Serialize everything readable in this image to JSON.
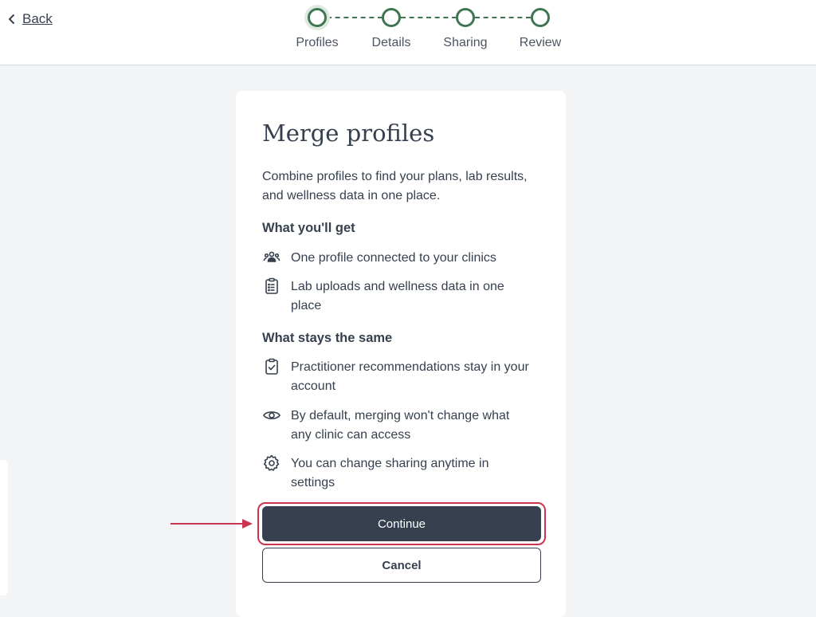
{
  "header": {
    "back_label": "Back",
    "steps": [
      {
        "label": "Profiles",
        "active": true
      },
      {
        "label": "Details",
        "active": false
      },
      {
        "label": "Sharing",
        "active": false
      },
      {
        "label": "Review",
        "active": false
      }
    ]
  },
  "card": {
    "title": "Merge profiles",
    "intro": "Combine profiles to find your plans, lab results, and wellness data in one place.",
    "section_get": {
      "heading": "What you'll get",
      "items": [
        {
          "icon": "people-icon",
          "text": "One profile connected to your clinics"
        },
        {
          "icon": "clipboard-list-icon",
          "text": "Lab uploads and wellness data in one place"
        }
      ]
    },
    "section_same": {
      "heading": "What stays the same",
      "items": [
        {
          "icon": "clipboard-check-icon",
          "text": "Practitioner recommendations stay in your account"
        },
        {
          "icon": "eye-icon",
          "text": "By default, merging won't change what any clinic can access"
        },
        {
          "icon": "gear-icon",
          "text": "You can change sharing anytime in settings"
        }
      ]
    },
    "continue_label": "Continue",
    "cancel_label": "Cancel"
  },
  "colors": {
    "accent_green": "#3f7652",
    "primary_dark": "#36404f",
    "highlight_red": "#c9344f",
    "background": "#f3f4f6"
  }
}
